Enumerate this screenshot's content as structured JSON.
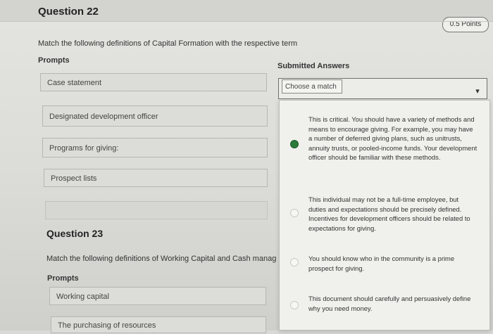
{
  "q22": {
    "title": "Question 22",
    "points": "0.5 Points",
    "instruction": "Match the following definitions of Capital Formation with the respective term",
    "prompts_label": "Prompts",
    "answers_label": "Submitted Answers",
    "prompts": [
      "Case statement",
      "Designated development officer",
      "Programs for giving:",
      "Prospect lists"
    ],
    "select_placeholder": "Choose a match",
    "options": [
      {
        "text": "This is critical. You should have a variety of methods and means to encourage giving. For example, you may have a number of deferred giving plans, such as unitrusts, annuity trusts, or pooled-income funds. Your development officer should be familiar with these methods.",
        "selected": true
      },
      {
        "text": "This individual may not be a full-time employee, but duties and expectations should be precisely defined. Incentives for development officers should be related to expectations for giving.",
        "selected": false
      },
      {
        "text": "You should know who in the community is a prime prospect for giving.",
        "selected": false
      },
      {
        "text": "This document should carefully and persuasively define why you need money.",
        "selected": false
      }
    ]
  },
  "q23": {
    "title": "Question 23",
    "instruction": "Match the following definitions of Working Capital and Cash manage",
    "prompts_label": "Prompts",
    "prompts": [
      "Working capital",
      "The purchasing of resources"
    ]
  },
  "colors": {
    "selected_radio": "#2a7a3a",
    "background": "#dcdcd8"
  },
  "icons": {
    "select_arrow": "chevron-down-icon"
  }
}
